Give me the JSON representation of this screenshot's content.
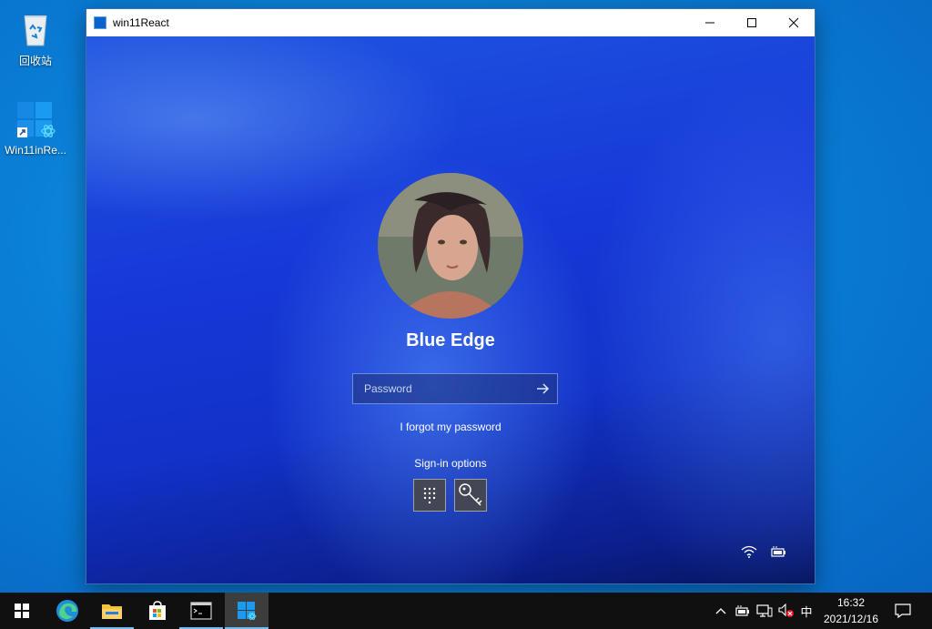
{
  "desktop": {
    "icons": [
      {
        "label": "回收站",
        "icon": "recycle-bin-icon"
      },
      {
        "label": "Win11inRe...",
        "icon": "win11-react-shortcut-icon"
      }
    ]
  },
  "window": {
    "title": "win11React",
    "controls": [
      "minimize-icon",
      "maximize-icon",
      "close-icon"
    ]
  },
  "lock_screen": {
    "username": "Blue Edge",
    "password_placeholder": "Password",
    "forgot_password_label": "I forgot my password",
    "signin_options_label": "Sign-in options",
    "signin_options": [
      "pin-keypad-icon",
      "key-icon"
    ],
    "status_icons": [
      "wifi-icon",
      "battery-icon"
    ]
  },
  "taskbar": {
    "apps": [
      "start-icon",
      "edge-icon",
      "file-explorer-icon",
      "store-icon",
      "terminal-icon",
      "win11react-app-icon"
    ],
    "ime_label": "中",
    "time": "16:32",
    "date": "2021/12/16",
    "accent_color": "#76b9ed"
  }
}
